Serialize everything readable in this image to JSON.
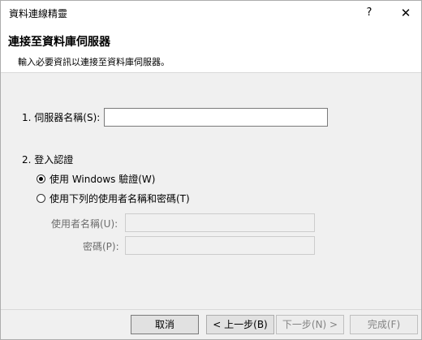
{
  "window": {
    "title": "資料連線精靈",
    "help": "?",
    "close": "✕"
  },
  "header": {
    "title": "連接至資料庫伺服器",
    "subtitle": "輸入必要資訊以連接至資料庫伺服器。"
  },
  "server": {
    "label": "1. 伺服器名稱(S):",
    "value": ""
  },
  "login": {
    "section_label": "2. 登入認證",
    "windows_auth": "使用 Windows 驗證(W)",
    "sql_auth": "使用下列的使用者名稱和密碼(T)",
    "selected": "windows_auth",
    "username_label": "使用者名稱(U):",
    "username_value": "",
    "password_label": "密碼(P):",
    "password_value": ""
  },
  "buttons": {
    "cancel": "取消",
    "back": "< 上一步(B)",
    "next": "下一步(N) >",
    "finish": "完成(F)"
  }
}
